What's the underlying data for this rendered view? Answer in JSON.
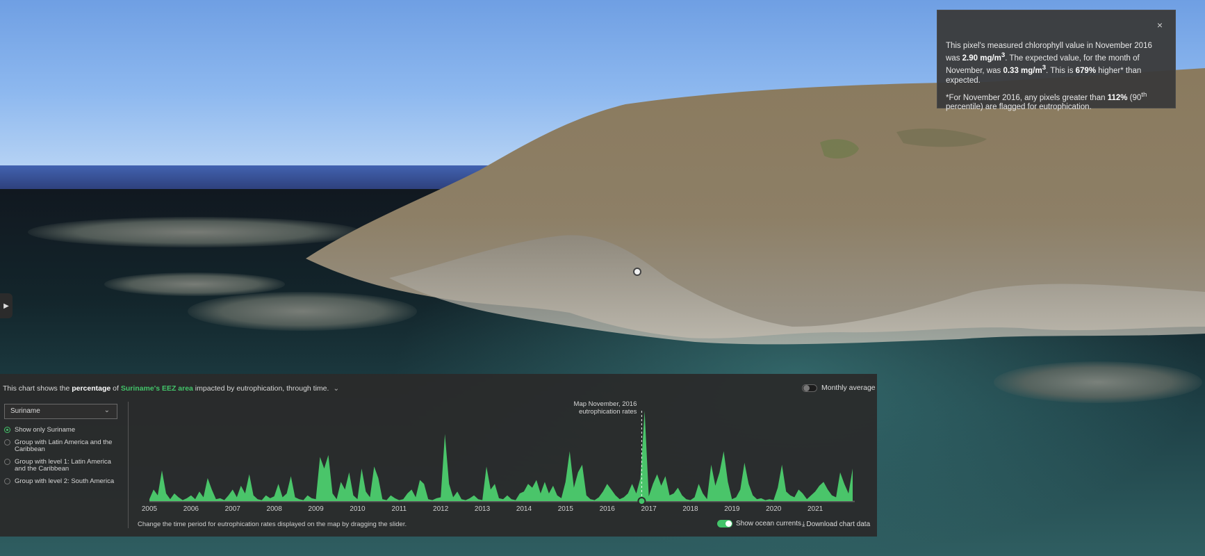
{
  "popup": {
    "close_label": "×",
    "text1_prefix": "This pixel's measured chlorophyll value in November 2016 was ",
    "value_measured": "2.90 mg/m",
    "text1_mid": ". The expected value, for the month of November, was ",
    "value_expected": "0.33 mg/m",
    "text1_mid2": ". This is ",
    "value_percent": "679%",
    "text1_suffix": " higher* than expected.",
    "text2_prefix": "*For November 2016, any pixels greater than ",
    "value_threshold": "112%",
    "text2_mid": " (90",
    "text2_sup": "th",
    "text2_suffix": " percentile) are flagged for eutrophication.",
    "superscript": "3"
  },
  "panel": {
    "head_prefix": "This chart shows the ",
    "head_bold": "percentage",
    "head_mid": " of ",
    "head_link": "Suriname's EEZ area",
    "head_suffix": " impacted by eutrophication, through time.",
    "head_chevron": "⌄",
    "monthly_label": "Monthly average",
    "select_value": "Suriname",
    "radios": [
      {
        "label": "Show only Suriname",
        "selected": true
      },
      {
        "label": "Group with Latin America and the Caribbean",
        "selected": false
      },
      {
        "label": "Group with level 1: Latin America and the Caribbean",
        "selected": false
      },
      {
        "label": "Group with level 2: South America",
        "selected": false
      }
    ],
    "footnote": "Change the time period for eutrophication rates displayed on the map by dragging the slider.",
    "currents_label": "Show ocean currents",
    "download_label": "Download chart data",
    "download_icon": "⤓"
  },
  "colors": {
    "accent": "#43c46a",
    "area_fill": "#4ccd6e"
  },
  "chart_data": {
    "type": "area",
    "title": "",
    "xlabel": "",
    "ylabel": "",
    "x_ticks": [
      "2005",
      "2006",
      "2007",
      "2008",
      "2009",
      "2010",
      "2011",
      "2012",
      "2013",
      "2014",
      "2015",
      "2016",
      "2017",
      "2018",
      "2019",
      "2020",
      "2021"
    ],
    "x_range": [
      2005,
      2021.95
    ],
    "ylim": [
      0,
      100
    ],
    "annotation": {
      "x": 2016.83,
      "label_line1": "Map November, 2016",
      "label_line2": "eutrophication rates"
    },
    "series": [
      {
        "x": [
          2005.0,
          2005.1,
          2005.2,
          2005.3,
          2005.4,
          2005.5,
          2005.6,
          2005.7,
          2005.8,
          2005.9,
          2006.0,
          2006.1,
          2006.2,
          2006.3,
          2006.4,
          2006.5,
          2006.6,
          2006.7,
          2006.8,
          2006.9,
          2007.0,
          2007.1,
          2007.2,
          2007.3,
          2007.4,
          2007.5,
          2007.6,
          2007.7,
          2007.8,
          2007.9,
          2008.0,
          2008.1,
          2008.2,
          2008.3,
          2008.4,
          2008.5,
          2008.6,
          2008.7,
          2008.8,
          2008.9,
          2009.0,
          2009.1,
          2009.2,
          2009.3,
          2009.4,
          2009.5,
          2009.6,
          2009.7,
          2009.8,
          2009.9,
          2010.0,
          2010.1,
          2010.2,
          2010.3,
          2010.4,
          2010.5,
          2010.6,
          2010.7,
          2010.8,
          2010.9,
          2011.0,
          2011.1,
          2011.2,
          2011.3,
          2011.4,
          2011.5,
          2011.6,
          2011.7,
          2011.8,
          2011.9,
          2012.0,
          2012.1,
          2012.2,
          2012.3,
          2012.4,
          2012.5,
          2012.6,
          2012.7,
          2012.8,
          2012.9,
          2013.0,
          2013.1,
          2013.2,
          2013.3,
          2013.4,
          2013.5,
          2013.6,
          2013.7,
          2013.8,
          2013.9,
          2014.0,
          2014.1,
          2014.2,
          2014.3,
          2014.4,
          2014.5,
          2014.6,
          2014.7,
          2014.8,
          2014.9,
          2015.0,
          2015.1,
          2015.2,
          2015.3,
          2015.4,
          2015.5,
          2015.6,
          2015.7,
          2015.8,
          2015.9,
          2016.0,
          2016.1,
          2016.2,
          2016.3,
          2016.4,
          2016.5,
          2016.6,
          2016.7,
          2016.8,
          2016.9,
          2017.0,
          2017.1,
          2017.2,
          2017.3,
          2017.4,
          2017.5,
          2017.6,
          2017.7,
          2017.8,
          2017.9,
          2018.0,
          2018.1,
          2018.2,
          2018.3,
          2018.4,
          2018.5,
          2018.6,
          2018.7,
          2018.8,
          2018.9,
          2019.0,
          2019.1,
          2019.2,
          2019.3,
          2019.4,
          2019.5,
          2019.6,
          2019.7,
          2019.8,
          2019.9,
          2020.0,
          2020.1,
          2020.2,
          2020.3,
          2020.4,
          2020.5,
          2020.6,
          2020.7,
          2020.8,
          2020.9,
          2021.0,
          2021.1,
          2021.2,
          2021.3,
          2021.4,
          2021.5,
          2021.6,
          2021.7,
          2021.8,
          2021.9
        ],
        "values": [
          2,
          12,
          6,
          32,
          8,
          2,
          8,
          4,
          1,
          3,
          6,
          2,
          10,
          4,
          24,
          12,
          2,
          3,
          1,
          6,
          12,
          4,
          16,
          8,
          28,
          6,
          2,
          1,
          6,
          3,
          5,
          18,
          4,
          8,
          26,
          4,
          2,
          1,
          6,
          3,
          2,
          46,
          34,
          48,
          8,
          2,
          20,
          12,
          30,
          6,
          2,
          34,
          10,
          4,
          36,
          24,
          2,
          1,
          6,
          3,
          1,
          2,
          8,
          12,
          4,
          22,
          18,
          2,
          1,
          3,
          4,
          70,
          18,
          4,
          10,
          2,
          1,
          3,
          6,
          2,
          1,
          36,
          12,
          18,
          3,
          2,
          6,
          2,
          1,
          8,
          10,
          18,
          14,
          22,
          8,
          20,
          8,
          16,
          6,
          3,
          20,
          52,
          14,
          30,
          38,
          6,
          2,
          1,
          4,
          10,
          18,
          12,
          6,
          2,
          4,
          8,
          18,
          8,
          24,
          94,
          5,
          18,
          28,
          16,
          26,
          6,
          8,
          14,
          6,
          2,
          1,
          4,
          18,
          8,
          2,
          38,
          16,
          30,
          52,
          20,
          2,
          4,
          12,
          40,
          18,
          6,
          2,
          3,
          1,
          2,
          1,
          14,
          38,
          10,
          6,
          4,
          12,
          8,
          2,
          6,
          10,
          16,
          20,
          12,
          6,
          4,
          30,
          18,
          8,
          34
        ]
      }
    ]
  }
}
